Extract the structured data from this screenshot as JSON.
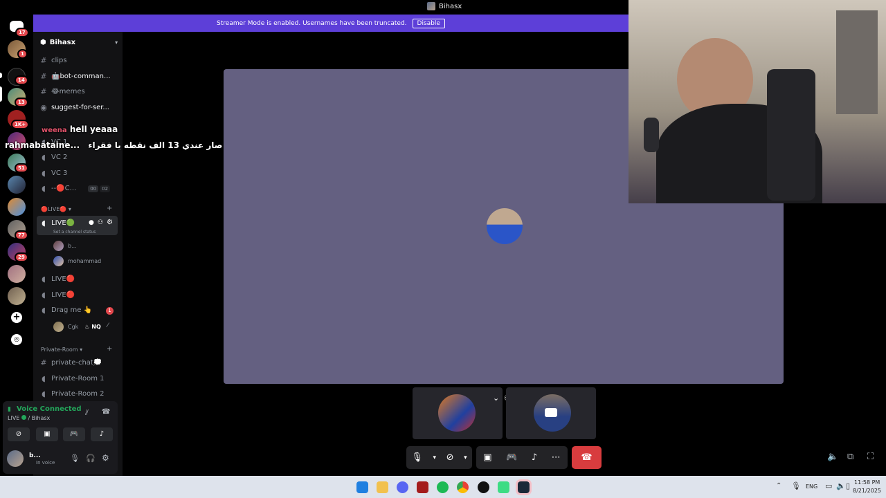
{
  "window": {
    "title": "Bihasx"
  },
  "banner": {
    "text": "Streamer Mode is enabled. Usernames have been truncated.",
    "button": "Disable"
  },
  "rail": {
    "badges": [
      "17",
      "1",
      "14",
      "13",
      "1K+",
      "51",
      "77",
      "29"
    ]
  },
  "sidebar": {
    "server_name": "Bihasx",
    "channels": [
      {
        "icon": "hash-icon",
        "label": "clips"
      },
      {
        "icon": "hash-icon",
        "label": "🤖bot-comman..."
      },
      {
        "icon": "hash-icon",
        "label": "😂memes"
      },
      {
        "icon": "forum-icon",
        "label": "suggest-for-ser..."
      }
    ],
    "voice_channels": [
      {
        "label": "VC 1"
      },
      {
        "label": "VC 2"
      },
      {
        "label": "VC 3"
      },
      {
        "label": "--🔴C...",
        "counter_a": "00",
        "counter_b": "02"
      }
    ],
    "live_category": "🔴LIVE🔴",
    "live_channel": {
      "label": "LIVE🟢",
      "status": "Set a channel status"
    },
    "live_users": [
      "b...",
      "mohammad"
    ],
    "other_live": [
      "LIVE🔴",
      "LIVE🔴"
    ],
    "drag": {
      "label": "Drag me 👆",
      "badge": "1"
    },
    "drag_user": {
      "name": "Cgk",
      "tag": "NQ"
    },
    "private_category": "Private-Room",
    "private_channels": [
      "private-chat💭",
      "Private-Room 1",
      "Private-Room 2"
    ]
  },
  "overlay": {
    "msg1_user": "weena",
    "msg1_text": "hell yeaaa",
    "msg2_user": "rahmabataine...",
    "msg2_text": "صار عندي 13 الف نقطه يا فقراء"
  },
  "voice_panel": {
    "title": "Voice Connected",
    "channel": "LIVE",
    "server": "/ Bihasx"
  },
  "user_panel": {
    "name": "b...",
    "status": "In voice"
  },
  "taskbar": {
    "lang": "ENG",
    "time": "11:58 PM",
    "date": "8/21/2025"
  },
  "colors": {
    "accent": "#5d3fd8",
    "stage": "#646081",
    "danger": "#d83c3e",
    "connected": "#23a55a"
  }
}
